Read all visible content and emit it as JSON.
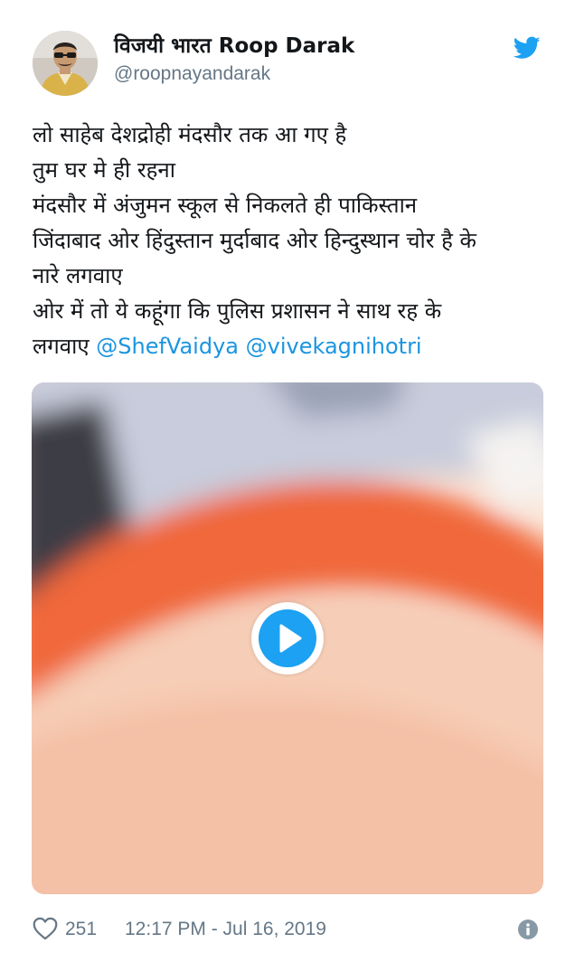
{
  "tweet": {
    "author": {
      "display_name": "विजयी भारत Roop Darak",
      "handle": "@roopnayandarak"
    },
    "text_lines": [
      "लो साहेब देशद्रोही मंदसौर तक आ गए है",
      "तुम घर मे ही रहना",
      "मंदसौर में अंजुमन स्कूल से निकलते ही पाकिस्तान",
      "जिंदाबाद ओर हिंदुस्तान मुर्दाबाद ओर हिन्दुस्थान चोर है के",
      "नारे लगवाए",
      "ओर में तो ये कहूंगा कि पुलिस प्रशासन ने साथ रह के"
    ],
    "last_line_prefix": "लगवाए ",
    "mentions": [
      "@ShefVaidya",
      "@vivekagnihotri"
    ],
    "likes": "251",
    "timestamp": "12:17 PM - Jul 16, 2019",
    "icons": {
      "brand": "twitter-bird-icon",
      "like": "heart-icon",
      "info": "info-icon",
      "play": "play-icon"
    },
    "colors": {
      "brand_blue": "#1da1f2",
      "mention_blue": "#1b95e0",
      "text": "#14171a",
      "secondary": "#657786"
    }
  }
}
